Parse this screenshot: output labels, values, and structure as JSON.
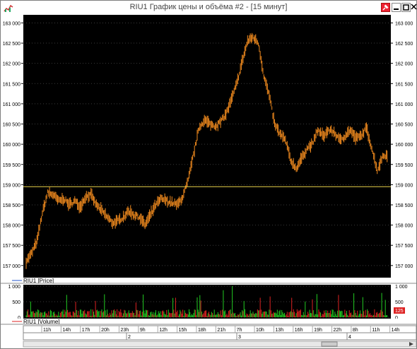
{
  "window": {
    "title": "RIU1 График цены и объёма #2 - [15 минут]"
  },
  "colors": {
    "background": "#000000",
    "candle": "#f08a1e",
    "level_line": "#e8d24a",
    "volume_up": "#22cc22",
    "volume_down": "#dd2222",
    "grid": "#3a3a3a",
    "axis_text": "#000000"
  },
  "price_panel": {
    "legend": "RIU1 [Price]",
    "level": 158950,
    "y_labels": [
      "163 000",
      "162 500",
      "162 000",
      "161 500",
      "161 000",
      "160 500",
      "160 000",
      "159 500",
      "159 000",
      "158 500",
      "158 000",
      "157 500",
      "157 000"
    ],
    "y_values": [
      163000,
      162500,
      162000,
      161500,
      161000,
      160500,
      160000,
      159500,
      159000,
      158500,
      158000,
      157500,
      157000
    ]
  },
  "volume_panel": {
    "legend": "RIU1 [Volume]",
    "y_labels": [
      "1 000",
      "500",
      "0"
    ],
    "y_values": [
      1000,
      500,
      0
    ],
    "last_value_label": "125"
  },
  "time_axis": {
    "hour_labels": [
      "11h",
      "14h",
      "17h",
      "20h",
      "23h",
      "9h",
      "12h",
      "15h",
      "18h",
      "21h",
      "7h",
      "10h",
      "13h",
      "16h",
      "19h",
      "22h",
      "8h",
      "11h",
      "14h"
    ],
    "day_labels": [
      "2",
      "3",
      "4"
    ]
  },
  "chart_data": {
    "type": "candlestick",
    "series": [
      {
        "name": "RIU1 [Price]",
        "points": [
          [
            "11h",
            157100
          ],
          [
            "11h",
            157300
          ],
          [
            "11h",
            157600
          ],
          [
            "12h",
            158300
          ],
          [
            "12h",
            158800
          ],
          [
            "13h",
            158750
          ],
          [
            "13h",
            158600
          ],
          [
            "14h",
            158650
          ],
          [
            "14h",
            158500
          ],
          [
            "15h",
            158600
          ],
          [
            "15h",
            158450
          ],
          [
            "16h",
            158700
          ],
          [
            "16h",
            158750
          ],
          [
            "17h",
            158500
          ],
          [
            "17h",
            158350
          ],
          [
            "18h",
            158200
          ],
          [
            "19h",
            158050
          ],
          [
            "20h",
            158100
          ],
          [
            "21h",
            158200
          ],
          [
            "22h",
            158350
          ],
          [
            "23h",
            158250
          ],
          [
            "0h",
            158200
          ],
          [
            "9h",
            158000
          ],
          [
            "9h",
            158250
          ],
          [
            "10h",
            158500
          ],
          [
            "11h",
            158650
          ],
          [
            "12h",
            158600
          ],
          [
            "13h",
            158550
          ],
          [
            "14h",
            158500
          ],
          [
            "15h",
            158700
          ],
          [
            "15h",
            159100
          ],
          [
            "16h",
            159750
          ],
          [
            "17h",
            160400
          ],
          [
            "17h",
            160600
          ],
          [
            "18h",
            160500
          ],
          [
            "19h",
            160450
          ],
          [
            "20h",
            160550
          ],
          [
            "21h",
            160750
          ],
          [
            "22h",
            161100
          ],
          [
            "23h",
            161500
          ],
          [
            "7h",
            162050
          ],
          [
            "7h",
            162550
          ],
          [
            "8h",
            162650
          ],
          [
            "8h",
            162500
          ],
          [
            "9h",
            161700
          ],
          [
            "9h",
            161200
          ],
          [
            "10h",
            160500
          ],
          [
            "11h",
            160250
          ],
          [
            "12h",
            160100
          ],
          [
            "13h",
            159600
          ],
          [
            "13h",
            159400
          ],
          [
            "14h",
            159650
          ],
          [
            "15h",
            159900
          ],
          [
            "16h",
            160000
          ],
          [
            "17h",
            160350
          ],
          [
            "18h",
            160200
          ],
          [
            "19h",
            160350
          ],
          [
            "20h",
            160300
          ],
          [
            "21h",
            160100
          ],
          [
            "22h",
            160200
          ],
          [
            "23h",
            160350
          ],
          [
            "8h",
            160150
          ],
          [
            "9h",
            160200
          ],
          [
            "10h",
            160400
          ],
          [
            "11h",
            159900
          ],
          [
            "12h",
            159350
          ],
          [
            "13h",
            159700
          ],
          [
            "14h",
            159750
          ]
        ]
      }
    ],
    "volume_y_range": [
      0,
      1000
    ],
    "price_y_range": [
      156700,
      163200
    ]
  }
}
